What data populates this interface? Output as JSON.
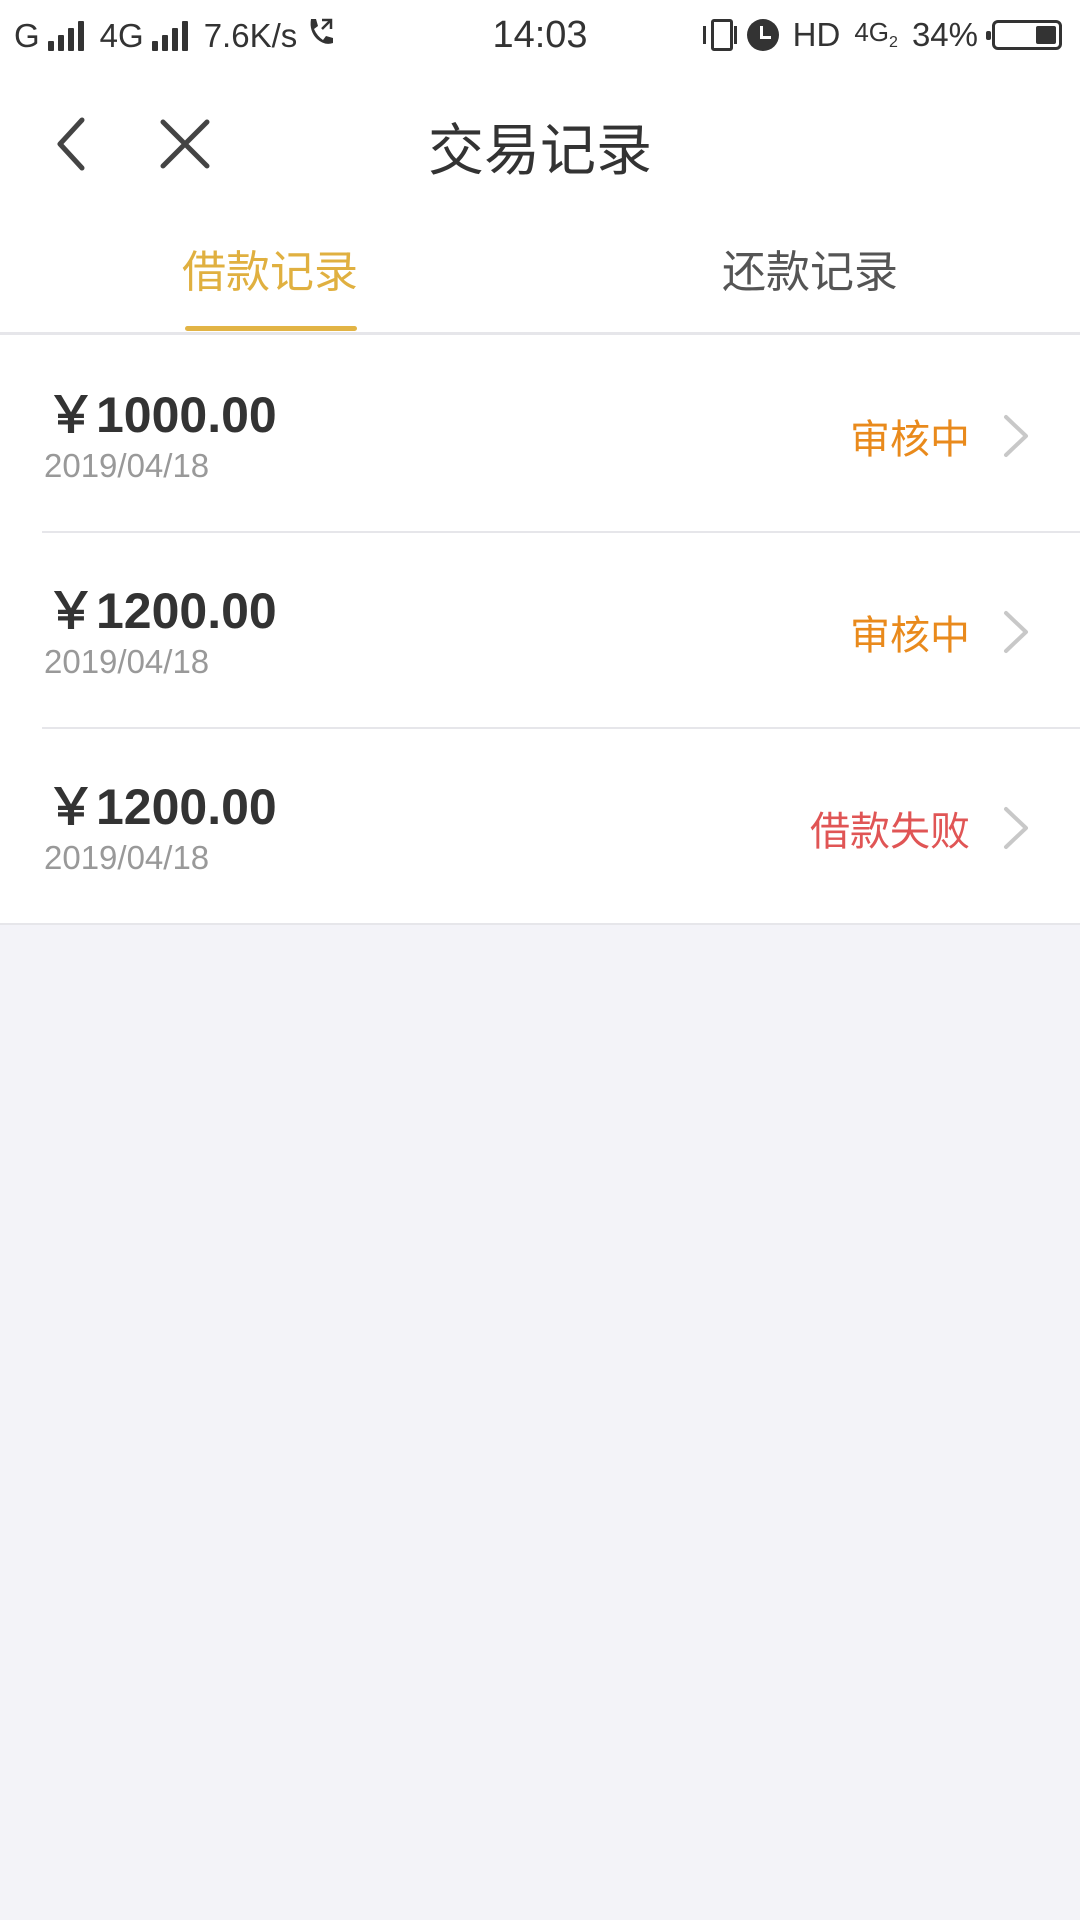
{
  "status_bar": {
    "carrier1": "G",
    "carrier2": "4G",
    "speed": "7.6K/s",
    "time": "14:03",
    "hd": "HD",
    "net": "4G",
    "net_sub": "2",
    "battery_text": "34%",
    "battery_level": 0.34
  },
  "header": {
    "title": "交易记录",
    "back_icon": "chevron-left-icon",
    "close_icon": "close-icon"
  },
  "tabs": [
    {
      "label": "借款记录",
      "active": true
    },
    {
      "label": "还款记录",
      "active": false
    }
  ],
  "records": [
    {
      "amount": "￥1000.00",
      "date": "2019/04/18",
      "status": "审核中",
      "status_type": "pending"
    },
    {
      "amount": "￥1200.00",
      "date": "2019/04/18",
      "status": "审核中",
      "status_type": "pending"
    },
    {
      "amount": "￥1200.00",
      "date": "2019/04/18",
      "status": "借款失败",
      "status_type": "failed"
    }
  ],
  "colors": {
    "accent": "#e0b040",
    "pending": "#e98a1c",
    "failed": "#e05555",
    "background": "#f3f3f8"
  }
}
